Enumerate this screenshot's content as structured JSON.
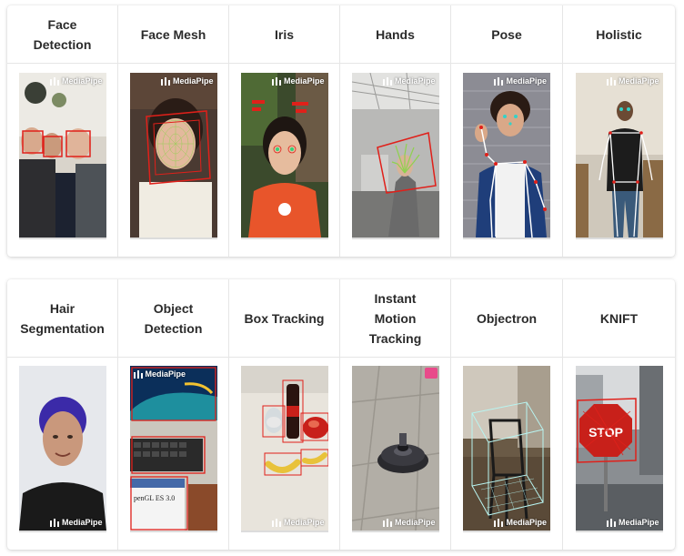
{
  "watermark": "MediaPipe",
  "rows": [
    {
      "solutions": [
        {
          "key": "face-detection",
          "label": "Face\nDetection"
        },
        {
          "key": "face-mesh",
          "label": "Face Mesh"
        },
        {
          "key": "iris",
          "label": "Iris"
        },
        {
          "key": "hands",
          "label": "Hands"
        },
        {
          "key": "pose",
          "label": "Pose"
        },
        {
          "key": "holistic",
          "label": "Holistic"
        }
      ]
    },
    {
      "solutions": [
        {
          "key": "hair-segmentation",
          "label": "Hair\nSegmentation"
        },
        {
          "key": "object-detection",
          "label": "Object\nDetection"
        },
        {
          "key": "box-tracking",
          "label": "Box Tracking"
        },
        {
          "key": "instant-motion-tracking",
          "label": "Instant\nMotion\nTracking"
        },
        {
          "key": "objectron",
          "label": "Objectron"
        },
        {
          "key": "knift",
          "label": "KNIFT"
        }
      ]
    }
  ],
  "thumbnail_text": {
    "object_detection_book": "penGL ES 3.0",
    "knift_sign": "STOP"
  }
}
